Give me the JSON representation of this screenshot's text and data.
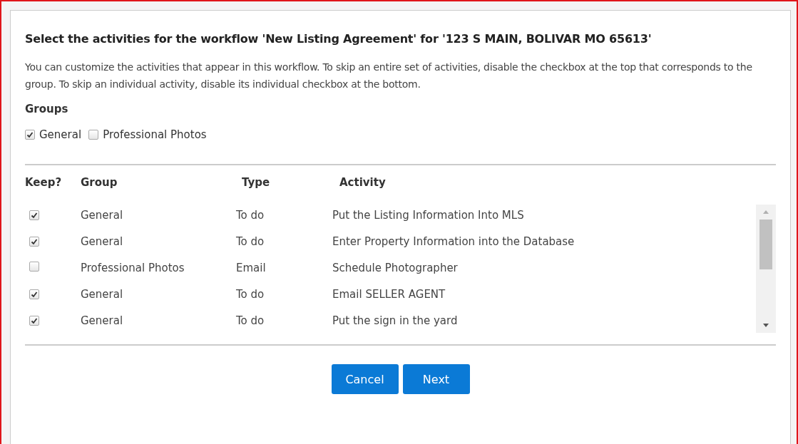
{
  "dialog": {
    "title": "Select the activities for the workflow 'New Listing Agreement' for '123 S MAIN, BOLIVAR MO 65613'",
    "description": "You can customize the activities that appear in this workflow. To skip an entire set of activities, disable the checkbox at the top that corresponds to the group. To skip an individual activity, disable its individual checkbox at the bottom.",
    "groups_label": "Groups",
    "groups": [
      {
        "label": "General",
        "checked": true
      },
      {
        "label": "Professional Photos",
        "checked": false
      }
    ],
    "table": {
      "columns": [
        "Keep?",
        "Group",
        "Type",
        "Activity"
      ],
      "rows": [
        {
          "keep": true,
          "group": "General",
          "type": "To do",
          "activity": "Put the Listing Information Into MLS"
        },
        {
          "keep": true,
          "group": "General",
          "type": "To do",
          "activity": "Enter Property Information into the Database"
        },
        {
          "keep": false,
          "group": "Professional Photos",
          "type": "Email",
          "activity": "Schedule Photographer"
        },
        {
          "keep": true,
          "group": "General",
          "type": "To do",
          "activity": "Email SELLER AGENT"
        },
        {
          "keep": true,
          "group": "General",
          "type": "To do",
          "activity": "Put the sign in the yard"
        }
      ]
    },
    "buttons": [
      "Cancel",
      "Next"
    ]
  }
}
